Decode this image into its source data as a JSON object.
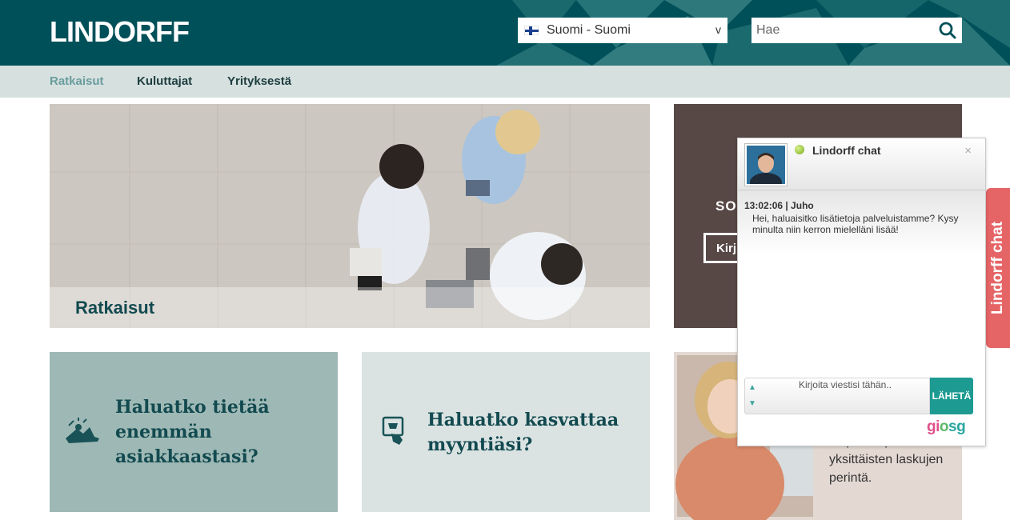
{
  "header": {
    "logo": "LINDORFF",
    "language": {
      "flag": "finland-flag",
      "label": "Suomi - Suomi",
      "caret": "v"
    },
    "search": {
      "placeholder": "Hae",
      "icon": "search-icon"
    }
  },
  "nav": {
    "items": [
      {
        "label": "Ratkaisut",
        "active": true
      },
      {
        "label": "Kuluttajat",
        "active": false
      },
      {
        "label": "Yrityksestä",
        "active": false
      }
    ]
  },
  "hero": {
    "title": "Ratkaisut"
  },
  "brown_card": {
    "title": "SO",
    "button": "Kirj"
  },
  "tiles": [
    {
      "text": "Haluatko tietää enemmän asiakkaastasi?",
      "icon": "puzzle-person-icon"
    },
    {
      "text": "Haluatko kasvattaa myyntiäsi?",
      "icon": "cart-hand-icon"
    }
  ],
  "woman_card": {
    "text": "helpoin tapa hoitaa yksittäisten laskujen perintä."
  },
  "side_tab": {
    "label": "Lindorff chat"
  },
  "chat": {
    "title": "Lindorff chat",
    "close": "×",
    "message": {
      "meta": "13:02:06 | Juho",
      "text": "Hei, haluaisitko lisätietoja palveluistamme? Kysy minulta niin kerron mielelläni lisää!"
    },
    "input_placeholder": "Kirjoita viestisi tähän..",
    "send_label": "LÄHETÄ",
    "brand": "giosg"
  },
  "colors": {
    "header_bg": "#005059",
    "nav_bg": "#d5e0df",
    "accent_red": "#e56466",
    "chat_send": "#1d9a91"
  }
}
